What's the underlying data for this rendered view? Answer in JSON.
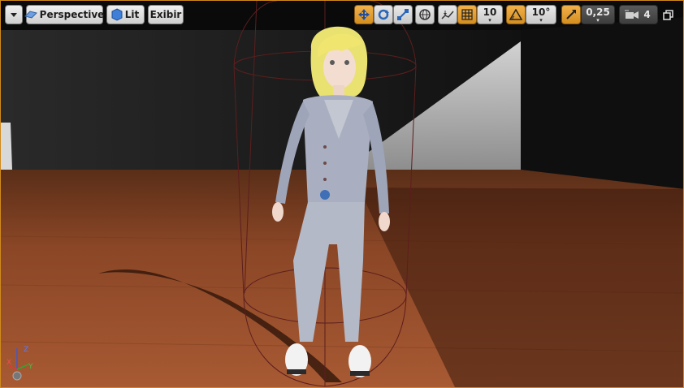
{
  "toolbar": {
    "viewport_options": {
      "icon": "chevron-down-icon"
    },
    "view_mode": {
      "label": "Perspective",
      "icon": "perspective-icon"
    },
    "lighting": {
      "label": "Lit",
      "icon": "lit-sphere-icon"
    },
    "show_menu": {
      "label": "Exibir"
    },
    "transform_tools": {
      "translate_icon": "move-icon",
      "rotate_icon": "rotate-icon",
      "scale_icon": "scale-icon"
    },
    "coordinate_space": {
      "icon": "world-icon"
    },
    "surface_snapping": {
      "icon": "surface-snap-icon"
    },
    "grid_snap": {
      "icon": "grid-icon",
      "value": "10"
    },
    "rotation_snap": {
      "icon": "angle-icon",
      "value": "10°"
    },
    "scale_snap": {
      "icon": "scale-snap-icon",
      "value": "0,25"
    },
    "camera_speed": {
      "icon": "camera-icon",
      "value": "4"
    },
    "maximize": {
      "icon": "maximize-icon"
    }
  },
  "axis_gizmo": {
    "x_label": "X",
    "y_label": "Y",
    "z_label": "Z"
  },
  "colors": {
    "accent_orange": "#E59B2A",
    "selection_outline": "#D08A1C",
    "floor": "#8C4A28"
  }
}
